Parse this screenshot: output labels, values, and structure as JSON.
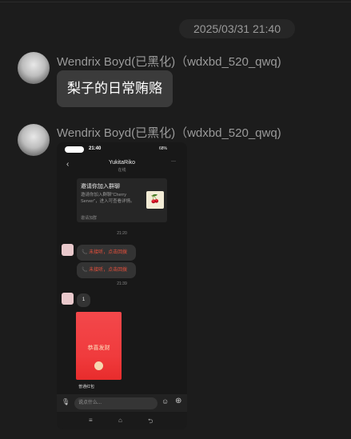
{
  "timestamp": "2025/03/31 21:40",
  "messages": [
    {
      "sender": "Wendrix Boyd(已黑化)（wdxbd_520_qwq)",
      "text": "梨子的日常贿赂"
    },
    {
      "sender": "Wendrix Boyd(已黑化)（wdxbd_520_qwq)",
      "type": "image"
    }
  ],
  "screenshot": {
    "time": "21:40",
    "battery": "68%",
    "title": "YukitaRiko",
    "subtitle": "在线",
    "invite_title": "邀请你加入群聊",
    "invite_body": "邀请你加入群聊\"Cherry Server\"，进入可查看详情。",
    "invite_footer": "邀请加群",
    "time1": "21:20",
    "call1": "未接听，点击回拨",
    "call2": "未接听，点击回拨",
    "time2": "21:39",
    "msg": "1",
    "redpacket_text": "恭喜发财",
    "redpacket_label": "普通红包",
    "input_placeholder": "说点什么..."
  }
}
